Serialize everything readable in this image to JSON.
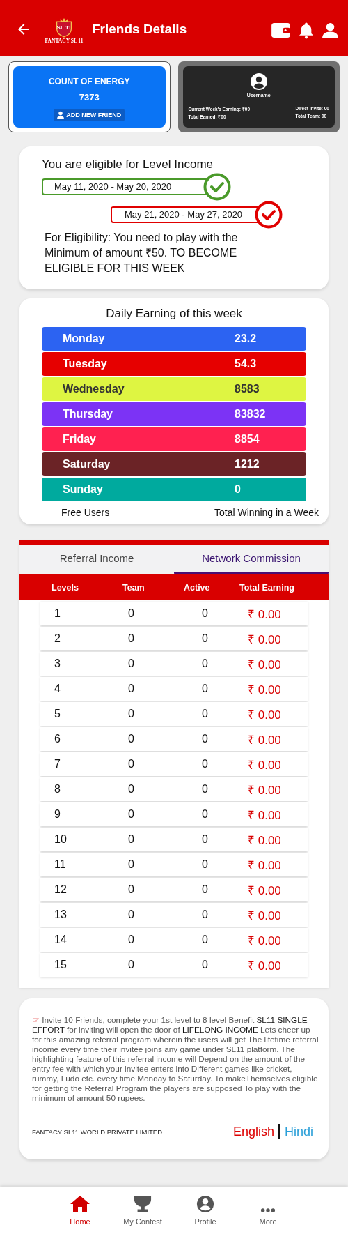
{
  "header": {
    "title": "Friends Details",
    "logo_text": "SL 11",
    "logo_caption": "FANTACY SL 11"
  },
  "energy_card": {
    "title": "COUNT OF ENERGY",
    "value": "7373",
    "button": "ADD NEW FRIEND"
  },
  "user_card": {
    "username": "Username",
    "stats": [
      {
        "label": "Current Week's Earning:",
        "value": "₹00"
      },
      {
        "label": "Direct Invite:",
        "value": "00"
      },
      {
        "label": "Total Earned:",
        "value": "₹00"
      },
      {
        "label": "Total Team:",
        "value": "00"
      }
    ]
  },
  "eligibility": {
    "title": "You are eligible for Level Income",
    "periods": [
      {
        "range": "May 11, 2020 - May 20, 2020",
        "eligible": true
      },
      {
        "range": "May 21, 2020 - May 27, 2020",
        "eligible": false
      }
    ],
    "note": "For Eligibility: You need to play with the Minimum of amount ₹50. TO BECOME ELIGIBLE FOR THIS WEEK"
  },
  "daily_earning": {
    "title": "Daily Earning of this week",
    "days": [
      {
        "day": "Monday",
        "amount": "23.2",
        "color": "#2c63f2"
      },
      {
        "day": "Tuesday",
        "amount": "54.3",
        "color": "#e60000"
      },
      {
        "day": "Wednesday",
        "amount": "8583",
        "color": "#def542"
      },
      {
        "day": "Thursday",
        "amount": "83832",
        "color": "#7c33f5"
      },
      {
        "day": "Friday",
        "amount": "8854",
        "color": "#ff2150"
      },
      {
        "day": "Saturday",
        "amount": "1212",
        "color": "#6b2326"
      },
      {
        "day": "Sunday",
        "amount": "0",
        "color": "#00aa9e"
      }
    ],
    "footer_left": "Free Users",
    "footer_right": "Total Winning in a Week"
  },
  "tabs": [
    {
      "label": "Referral Income",
      "selected": false
    },
    {
      "label": "Network Commission",
      "selected": true
    }
  ],
  "table": {
    "columns": [
      "Levels",
      "Team",
      "Active",
      "Total Earning"
    ],
    "rows": [
      [
        "1",
        "0",
        "0",
        "₹ 0.00"
      ],
      [
        "2",
        "0",
        "0",
        "₹ 0.00"
      ],
      [
        "3",
        "0",
        "0",
        "₹ 0.00"
      ],
      [
        "4",
        "0",
        "0",
        "₹ 0.00"
      ],
      [
        "5",
        "0",
        "0",
        "₹ 0.00"
      ],
      [
        "6",
        "0",
        "0",
        "₹ 0.00"
      ],
      [
        "7",
        "0",
        "0",
        "₹ 0.00"
      ],
      [
        "8",
        "0",
        "0",
        "₹ 0.00"
      ],
      [
        "9",
        "0",
        "0",
        "₹ 0.00"
      ],
      [
        "10",
        "0",
        "0",
        "₹ 0.00"
      ],
      [
        "11",
        "0",
        "0",
        "₹ 0.00"
      ],
      [
        "12",
        "0",
        "0",
        "₹ 0.00"
      ],
      [
        "13",
        "0",
        "0",
        "₹ 0.00"
      ],
      [
        "14",
        "0",
        "0",
        "₹ 0.00"
      ],
      [
        "15",
        "0",
        "0",
        "₹ 0.00"
      ]
    ]
  },
  "info": {
    "icon": "☞",
    "text": "Invite 10 Friends, complete your 1st level to 8 level Benefit **SL11 SINGLE EFFORT** for inviting will open the door of **LIFELONG INCOME** Lets cheer up for this amazing referral program wherein the users will get The lifetime referral income every time their invitee joins any game under SL11 platform. The highlighting feature of this referral income will Depend on the amount of the entry fee with which your invitee enters into Different games like cricket, rummy, Ludo etc. every time Monday to Saturday. To makeThemselves eligible for getting the Referral Program the players are supposed To play with the minimum of amount 50 rupees.",
    "company": "FANTACY SL11 WORLD PRIVATE LIMITED",
    "languages": [
      {
        "label": "English",
        "selected": true
      },
      {
        "label": "Hindi",
        "selected": false
      }
    ]
  },
  "bottom_nav": [
    {
      "label": "Home",
      "kind": "home",
      "selected": true
    },
    {
      "label": "My Contest",
      "kind": "trophy",
      "selected": false
    },
    {
      "label": "Profile",
      "kind": "profile",
      "selected": false
    },
    {
      "label": "More",
      "kind": "more",
      "selected": false
    }
  ]
}
